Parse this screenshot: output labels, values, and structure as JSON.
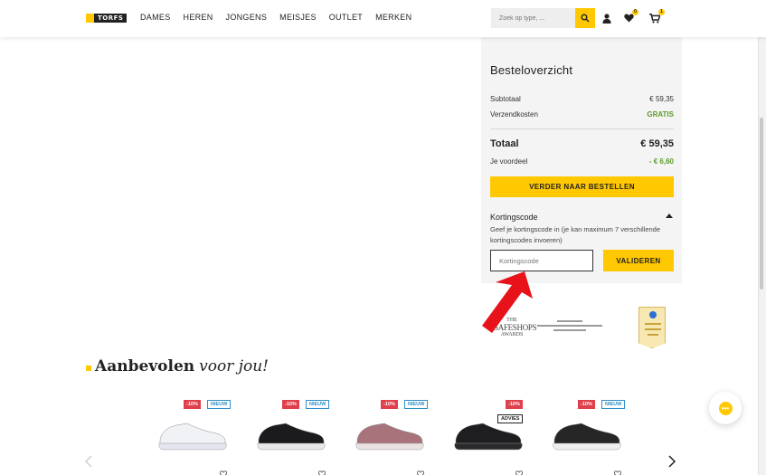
{
  "header": {
    "logo_text": "TORFS",
    "nav": [
      "DAMES",
      "HEREN",
      "JONGENS",
      "MEISJES",
      "OUTLET",
      "MERKEN"
    ],
    "search_placeholder": "Zoek op type, ...",
    "wishlist_count": "0",
    "cart_count": "1"
  },
  "summary": {
    "title": "Besteloverzicht",
    "subtotal_label": "Subtotaal",
    "subtotal_value": "€ 59,35",
    "shipping_label": "Verzendkosten",
    "shipping_value": "GRATIS",
    "total_label": "Totaal",
    "total_value": "€ 59,35",
    "advantage_label": "Je voordeel",
    "advantage_value": "- € 6,60",
    "checkout_button": "VERDER NAAR BESTELLEN",
    "coupon": {
      "title": "Kortingscode",
      "description": "Geef je kortingscode in (je kan maximum 7 verschillende kortingscodes invoeren)",
      "placeholder": "Kortingscode",
      "validate_button": "VALIDEREN"
    }
  },
  "awards": {
    "safeshops_line1": "THE",
    "safeshops_line2": "SAFESHOPS",
    "safeshops_line3": "AWARDS"
  },
  "recommendations": {
    "title_bold": "Aanbevolen",
    "title_italic": "voor jou!",
    "products": [
      {
        "discount": "-10%",
        "label": "NIEUW",
        "shoe_color": "#f1f2f6",
        "sole_color": "#e3e6ee"
      },
      {
        "discount": "-10%",
        "label": "NIEUW",
        "shoe_color": "#1b1b1d",
        "sole_color": "#e8e8e8"
      },
      {
        "discount": "-10%",
        "label": "NIEUW",
        "shoe_color": "#a9737c",
        "sole_color": "#e9e2e2"
      },
      {
        "discount": "-10%",
        "label": "ADVIES",
        "shoe_color": "#1e1e20",
        "sole_color": "#2a2a2c"
      },
      {
        "discount": "-10%",
        "label": "NIEUW",
        "shoe_color": "#262626",
        "sole_color": "#efefef"
      }
    ]
  }
}
